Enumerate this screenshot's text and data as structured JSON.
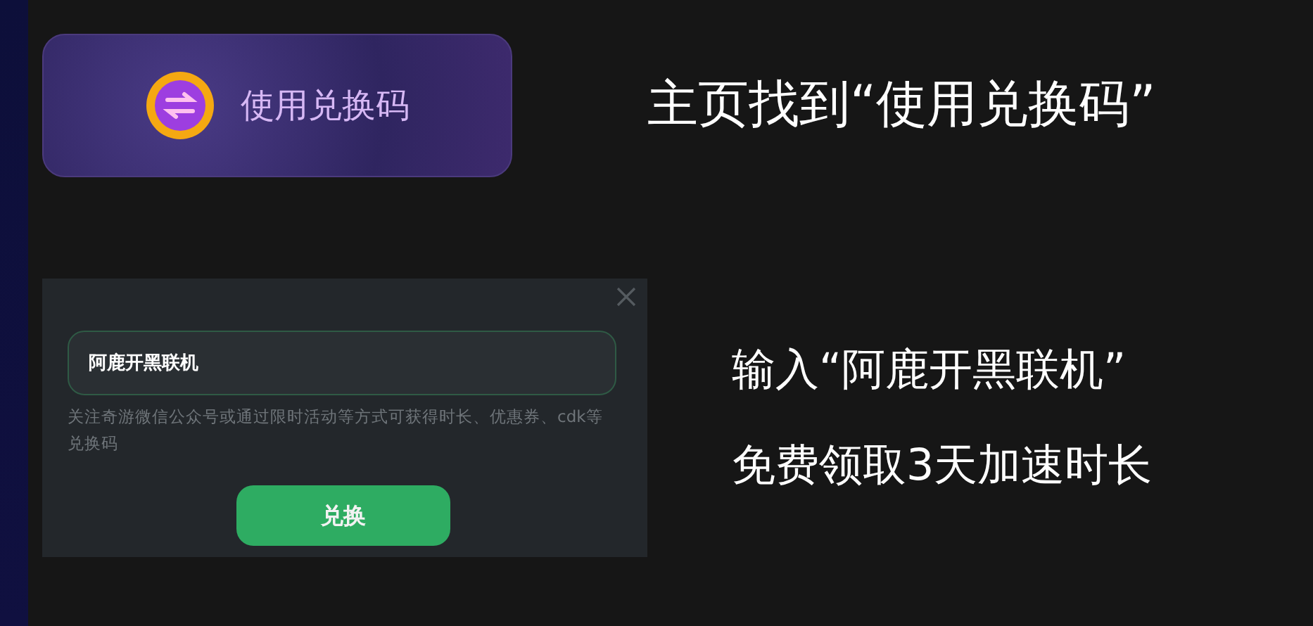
{
  "home_card": {
    "button_label": "使用兑换码"
  },
  "caption_1": "主页找到“使用兑换码”",
  "dialog": {
    "input_value": "阿鹿开黑联机",
    "hint": "关注奇游微信公众号或通过限时活动等方式可获得时长、优惠券、cdk等兑换码",
    "submit_label": "兑换"
  },
  "caption_2": [
    "输入“阿鹿开黑联机”",
    "免费领取3天加速时长"
  ]
}
